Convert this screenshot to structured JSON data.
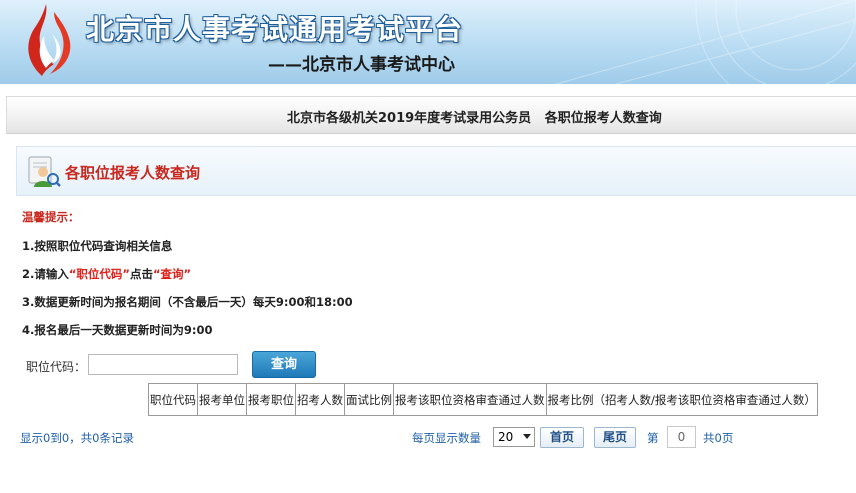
{
  "banner": {
    "title": "北京市人事考试通用考试平台",
    "subtitle": "——北京市人事考试中心",
    "logo_icon": "flame-logo-icon"
  },
  "titlebar": {
    "text": "北京市各级机关2019年度考试录用公务员   各职位报考人数查询"
  },
  "panel": {
    "title": "各职位报考人数查询",
    "icon": "user-search-icon"
  },
  "tips": {
    "title": "温馨提示：",
    "line1": "1.按照职位代码查询相关信息",
    "line2_prefix": "2.请输入",
    "line2_code": "“职位代码”",
    "line2_mid": "点击",
    "line2_query": "“查询”",
    "line3": "3.数据更新时间为报名期间（不含最后一天）每天9:00和18:00",
    "line4": "4.报名最后一天数据更新时间为9:00"
  },
  "search": {
    "label": "职位代码：",
    "value": "",
    "placeholder": "",
    "button_label": "查询"
  },
  "table": {
    "columns": [
      "职位代码",
      "报考单位",
      "报考职位",
      "招考人数",
      "面试比例",
      "报考该职位资格审查通过人数",
      "报考比例（招考人数/报考该职位资格审查通过人数）"
    ],
    "rows": []
  },
  "pager": {
    "info": "显示0到0，共0条记录",
    "size_label": "每页显示数量",
    "size_value": "20",
    "first_label": "首页",
    "last_label": "尾页",
    "page_prefix": "第",
    "page_value": "0",
    "page_suffix": "共0页"
  },
  "colors": {
    "banner_blue": "#b9dcf3",
    "title_red": "#c8281e",
    "button_blue": "#1f79b8",
    "link_blue": "#1f5fa8"
  }
}
